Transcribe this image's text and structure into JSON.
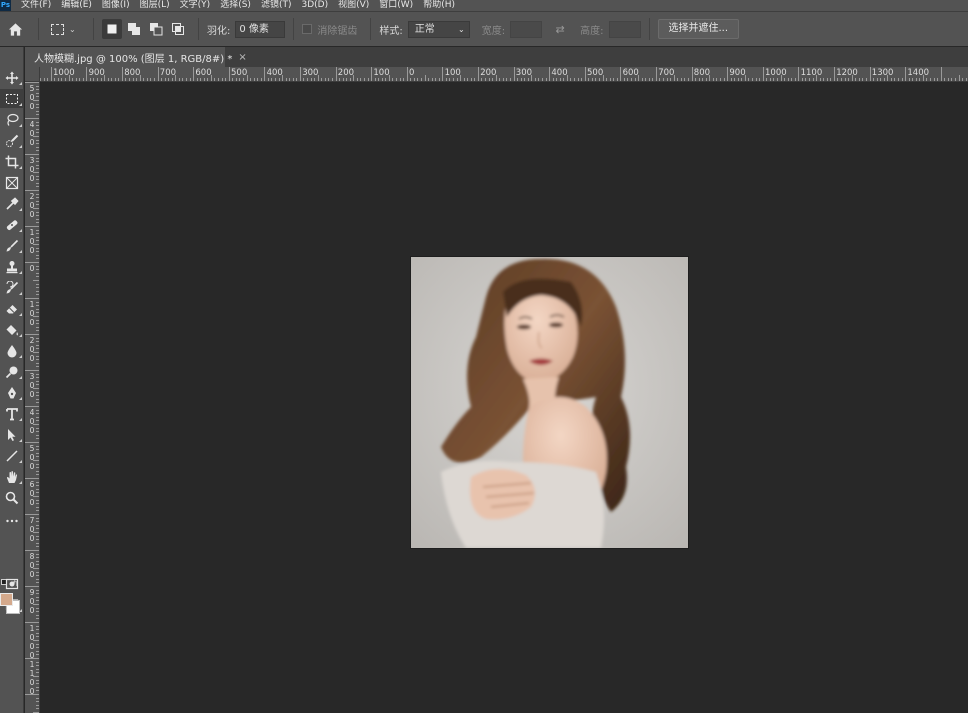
{
  "app": {
    "logo": "Ps"
  },
  "menu": [
    "文件(F)",
    "编辑(E)",
    "图像(I)",
    "图层(L)",
    "文字(Y)",
    "选择(S)",
    "滤镜(T)",
    "3D(D)",
    "视图(V)",
    "窗口(W)",
    "帮助(H)"
  ],
  "options": {
    "feather_label": "羽化:",
    "feather_value": "0 像素",
    "antialias_label": "消除锯齿",
    "style_label": "样式:",
    "style_value": "正常",
    "width_label": "宽度:",
    "height_label": "高度:",
    "refine_button": "选择并遮住..."
  },
  "document": {
    "tab_title": "人物模糊.jpg @ 100% (图层 1, RGB/8#) *",
    "close_glyph": "×"
  },
  "ruler": {
    "top_labels": [
      "1000",
      "900",
      "800",
      "700",
      "600",
      "500",
      "400",
      "300",
      "200",
      "100",
      "0",
      "100",
      "200",
      "300",
      "400",
      "500",
      "600",
      "700",
      "800",
      "900",
      "1000",
      "1100",
      "1200",
      "1300",
      "1400"
    ],
    "left_labels": [
      "5\n0\n0",
      "4\n0\n0",
      "3\n0\n0",
      "2\n0\n0",
      "1\n0\n0",
      "0",
      "1\n0\n0",
      "2\n0\n0",
      "3\n0\n0",
      "4\n0\n0",
      "5\n0\n0",
      "6\n0\n0",
      "7\n0\n0",
      "8\n0\n0",
      "9\n0\n0",
      "1\n0\n0\n0",
      "1\n1\n0\n0"
    ]
  },
  "tools": [
    "move-tool",
    "rectangular-marquee-tool",
    "lasso-tool",
    "quick-selection-tool",
    "crop-tool",
    "frame-tool",
    "eyedropper-tool",
    "spot-healing-brush-tool",
    "brush-tool",
    "clone-stamp-tool",
    "history-brush-tool",
    "eraser-tool",
    "paint-bucket-tool",
    "blur-tool",
    "dodge-tool",
    "pen-tool",
    "type-tool",
    "path-selection-tool",
    "line-tool",
    "hand-tool",
    "zoom-tool",
    "edit-toolbar"
  ],
  "colors": {
    "foreground": "#d4a98c",
    "background": "#ffffff",
    "ui_panel": "#535353",
    "canvas_bg": "#282828"
  }
}
